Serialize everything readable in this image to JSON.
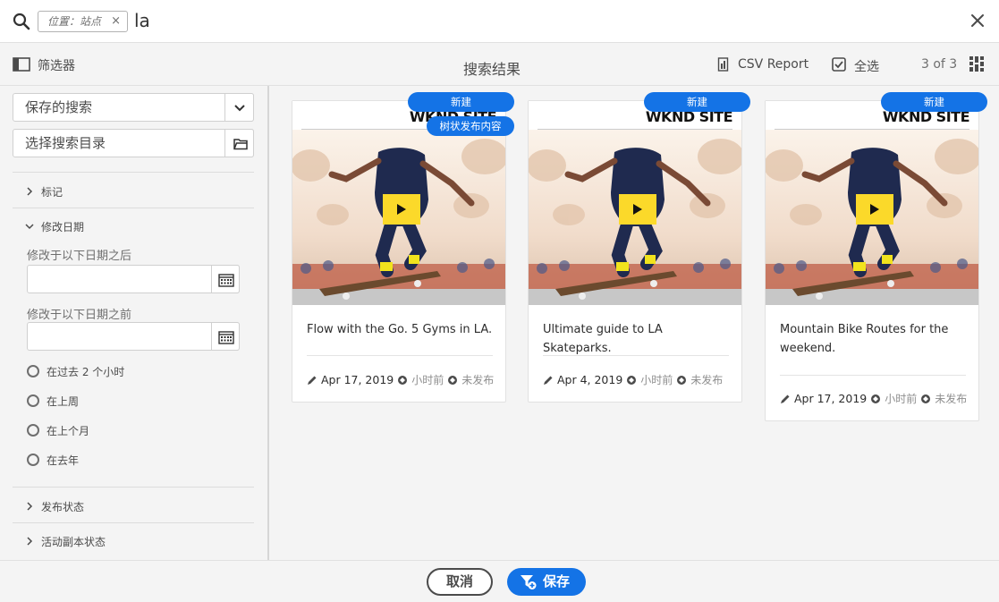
{
  "search": {
    "scope_tag": "位置：站点",
    "scope_tag_close": "×",
    "query": "la",
    "icons": [
      "search-icon",
      "close-icon"
    ]
  },
  "toolbar": {
    "filter_label": "筛选器",
    "title": "搜索结果",
    "csv_label": "CSV Report",
    "select_all_label": "全选",
    "count": "3 of 3",
    "icons": [
      "filter-rail-icon",
      "csv-report-icon",
      "select-all-icon",
      "grid-view-icon"
    ]
  },
  "sidebar": {
    "saved_search_placeholder": "保存的搜索",
    "select_directory_placeholder": "选择搜索目录",
    "sections": {
      "tags": "标记",
      "modified_date": "修改日期",
      "publish_status": "发布状态",
      "live_copy_status": "活动副本状态"
    },
    "modified_after_label": "修改于以下日期之后",
    "modified_before_label": "修改于以下日期之前",
    "radios": [
      {
        "label": "在过去  2  个小时"
      },
      {
        "label": "在上周"
      },
      {
        "label": "在上个月"
      },
      {
        "label": "在去年"
      }
    ]
  },
  "cards": [
    {
      "thumb_brand": "WKND SITE",
      "title": "Flow with the Go. 5 Gyms in LA.",
      "date": "Apr 17, 2019",
      "time_ago": "小时前",
      "status": "未发布",
      "badges": [
        "新建",
        "树状发布内容"
      ]
    },
    {
      "thumb_brand": "WKND SITE",
      "title": "Ultimate guide to LA Skateparks.",
      "date": "Apr 4, 2019",
      "time_ago": "小时前",
      "status": "未发布",
      "badges": [
        "新建"
      ]
    },
    {
      "thumb_brand": "WKND SITE",
      "title": "Mountain Bike Routes for the weekend.",
      "date": "Apr 17, 2019",
      "time_ago": "小时前",
      "status": "未发布",
      "badges": [
        "新建"
      ]
    }
  ],
  "footer": {
    "cancel_label": "取消",
    "save_label": "保存"
  },
  "colors": {
    "accent": "#1473e6",
    "play_button": "#fbd92a",
    "background": "#f4f4f4"
  }
}
